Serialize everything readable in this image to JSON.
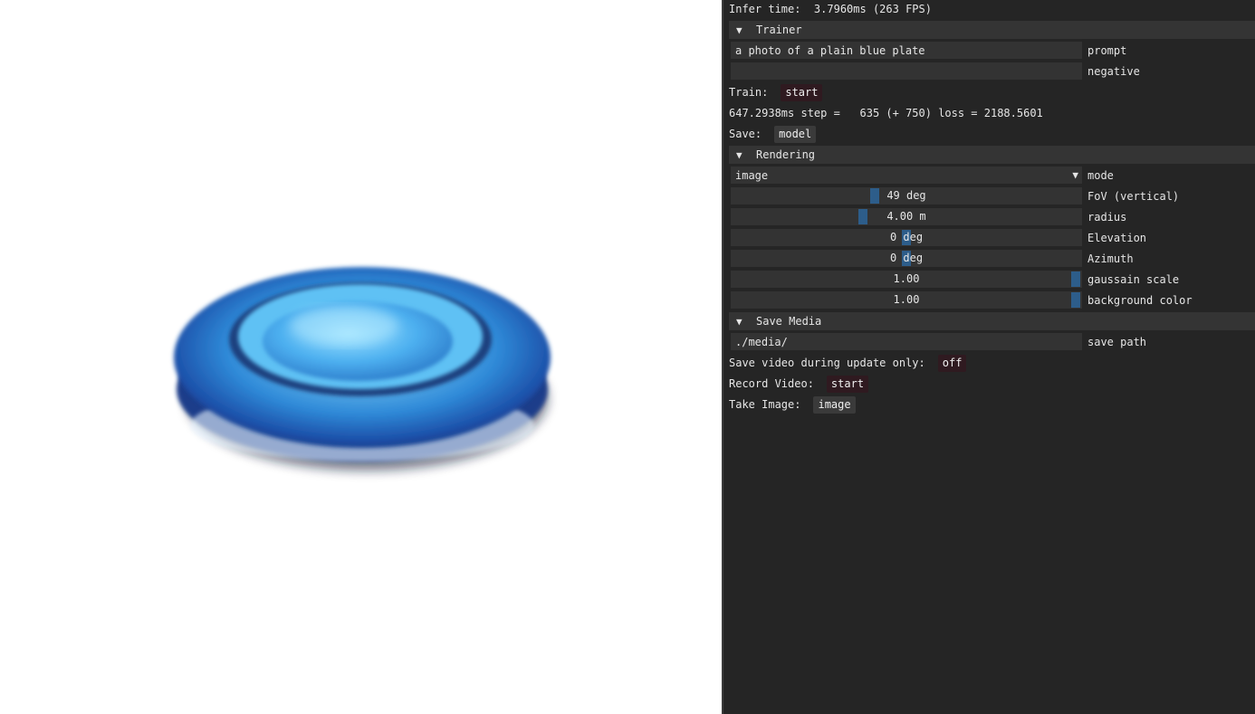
{
  "infer_time": "Infer time:  3.7960ms (263 FPS)",
  "trainer": {
    "header": "Trainer",
    "prompt_value": "a photo of a plain blue plate",
    "prompt_label": "prompt",
    "negative_value": "",
    "negative_label": "negative",
    "train_label": "Train:",
    "train_button": "start",
    "step_status": "647.2938ms step =   635 (+ 750) loss = 2188.5601",
    "save_label": "Save:",
    "save_button": "model"
  },
  "rendering": {
    "header": "Rendering",
    "mode_value": "image",
    "mode_label": "mode",
    "fov_value": "49 deg",
    "fov_label": "FoV (vertical)",
    "radius_value": "4.00 m",
    "radius_label": "radius",
    "elevation_value": "0 deg",
    "elevation_label": "Elevation",
    "azimuth_value": "0 deg",
    "azimuth_label": "Azimuth",
    "gaussain_scale_value": "1.00",
    "gaussain_scale_label": "gaussain scale",
    "background_color_value": "1.00",
    "background_color_label": "background color"
  },
  "save_media": {
    "header": "Save Media",
    "path_value": "./media/",
    "path_label": "save path",
    "save_video_label": "Save video during update only:",
    "save_video_button": "off",
    "record_label": "Record Video:",
    "record_button": "start",
    "take_image_label": "Take Image:",
    "take_image_button": "image"
  },
  "icons": {
    "collapse": "triangle-down-icon",
    "combo": "triangle-down-icon"
  },
  "colors": {
    "panel_bg": "#252525",
    "header_bg": "#343434",
    "field_bg": "#333333",
    "button_bg": "#2f1a20",
    "slider_grab": "#2d5d8a",
    "viewport_bg": "#ffffff"
  }
}
